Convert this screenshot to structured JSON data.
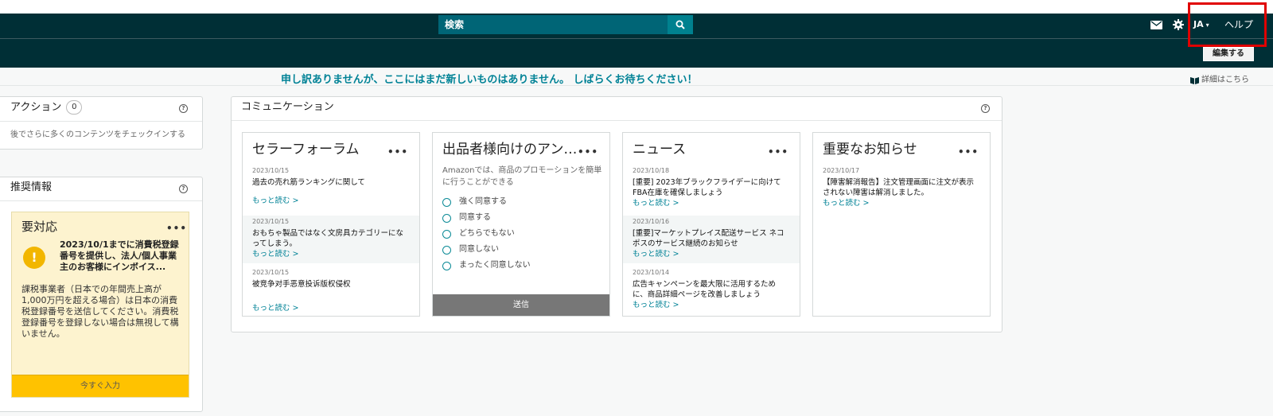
{
  "header": {
    "search_placeholder": "検索",
    "lang_label": "JA",
    "lang_caret": "▾",
    "help_label": "ヘルプ",
    "icons": [
      "mail-icon",
      "gear-icon",
      "search-icon"
    ]
  },
  "subbar": {
    "edit_label": "編集する"
  },
  "notice": {
    "sorry_text": "申し訳ありませんが、ここにはまだ新しいものはありません。 しばらくお待ちください！",
    "details_label": "詳細はこちら"
  },
  "actions": {
    "title": "アクション",
    "count": "0",
    "help": "?",
    "empty_text": "後でさらに多くのコンテンツをチェックインする"
  },
  "recommend": {
    "title": "推奨情報",
    "help": "?",
    "card": {
      "title": "要対応",
      "dots": "•••",
      "warn": "!",
      "headline": "2023/10/1までに消費税登録番号を提供し、法人/個人事業主のお客様にインボイス...",
      "body": "課税事業者（日本での年間売上高が1,000万円を超える場合）は日本の消費税登録番号を送信してください。消費税登録番号を登録しない場合は無視して構いません。",
      "button": "今すぐ入力"
    }
  },
  "communication": {
    "title": "コミュニケーション",
    "help": "?",
    "forum": {
      "title": "セラーフォーラム",
      "dots": "•••",
      "items": [
        {
          "date": "2023/10/15",
          "title": "過去の売れ筋ランキングに関して",
          "more": "もっと読む >"
        },
        {
          "date": "2023/10/15",
          "title": "おもちゃ製品ではなく文房具カテゴリーになってしまう。",
          "more": "もっと読む >"
        },
        {
          "date": "2023/10/15",
          "title": "被竞争对手恶意投诉版权侵权",
          "more": "もっと読む >"
        }
      ]
    },
    "survey": {
      "title": "出品者様向けのアンケ...",
      "dots": "•••",
      "question": "Amazonでは、商品のプロモーションを簡単に行うことができる",
      "options": [
        "強く同意する",
        "同意する",
        "どちらでもない",
        "同意しない",
        "まったく同意しない"
      ],
      "submit": "送信"
    },
    "news": {
      "title": "ニュース",
      "dots": "•••",
      "items": [
        {
          "date": "2023/10/18",
          "title": "[重要] 2023年ブラックフライデーに向けてFBA在庫を確保しましょう",
          "more": "もっと読む >"
        },
        {
          "date": "2023/10/16",
          "title": "[重要]マーケットプレイス配送サービス ネコポスのサービス継続のお知らせ",
          "more": "もっと読む >"
        },
        {
          "date": "2023/10/14",
          "title": "広告キャンペーンを最大限に活用するために、商品詳細ページを改善しましょう",
          "more": "もっと読む >"
        }
      ]
    },
    "important": {
      "title": "重要なお知らせ",
      "dots": "•••",
      "items": [
        {
          "date": "2023/10/17",
          "title": "【障害解消報告】注文管理画面に注文が表示されない障害は解消しました。",
          "more": "もっと読む >"
        }
      ]
    }
  }
}
